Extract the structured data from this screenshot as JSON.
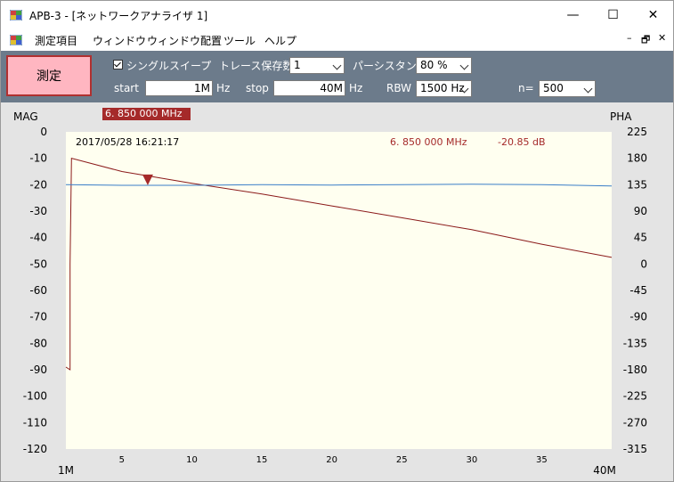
{
  "window": {
    "title": "APB-3 - [ネットワークアナライザ 1]",
    "minimize": "—",
    "maximize": "☐",
    "close": "✕"
  },
  "menu": {
    "items": [
      "測定項目",
      "ウィンドウ",
      "ウィンドウ配置",
      "ツール",
      "ヘルプ"
    ],
    "mdi": [
      "–",
      "🗗",
      "✕"
    ]
  },
  "toolbar": {
    "measure_label": "測定",
    "single_sweep_label": "シングルスイープ",
    "single_sweep_checked": true,
    "trace_save_label": "トレース保存数",
    "trace_save_value": "1",
    "persistence_label": "パーシスタンス",
    "persistence_value": "80 %",
    "start_label": "start",
    "start_value": "1M",
    "start_unit": "Hz",
    "stop_label": "stop",
    "stop_value": "40M",
    "stop_unit": "Hz",
    "rbw_label": "RBW",
    "rbw_value": "1500 Hz",
    "n_label": "n=",
    "n_value": "500"
  },
  "chart": {
    "left_axis_title": "MAG",
    "right_axis_title": "PHA",
    "marker_freq_box": "6. 850 000 MHz",
    "timestamp": "2017/05/28 16:21:17",
    "marker_freq_readout": "6. 850 000 MHz",
    "marker_value_readout": "-20.85 dB",
    "colors": {
      "magnitude": "#8b1a1a",
      "phase": "#3a7ec8",
      "plot_bg": "#fffff0"
    }
  },
  "chart_data": {
    "type": "line",
    "x_range": [
      1,
      40
    ],
    "x_unit": "MHz",
    "x_ticks": [
      5,
      10,
      15,
      20,
      25,
      30,
      35
    ],
    "x_end_labels": [
      "1M",
      "40M"
    ],
    "left_axis": {
      "title": "MAG",
      "range": [
        -120,
        0
      ],
      "ticks": [
        0,
        -10,
        -20,
        -30,
        -40,
        -50,
        -60,
        -70,
        -80,
        -90,
        -100,
        -110,
        -120
      ]
    },
    "right_axis": {
      "title": "PHA",
      "range": [
        -315,
        225
      ],
      "ticks": [
        225,
        180,
        135,
        90,
        45,
        0,
        -45,
        -90,
        -135,
        -180,
        -225,
        -270,
        -315
      ]
    },
    "marker": {
      "x": 6.85,
      "y": -20.85
    },
    "series": [
      {
        "axis": "left",
        "points": [
          [
            1,
            -89
          ],
          [
            1.3,
            -90
          ],
          [
            1.3,
            -50
          ],
          [
            1.4,
            -10
          ],
          [
            5,
            -15
          ],
          [
            10,
            -19.5
          ],
          [
            15,
            -23.5
          ],
          [
            20,
            -28
          ],
          [
            25,
            -32.5
          ],
          [
            30,
            -37
          ],
          [
            35,
            -42.5
          ],
          [
            40,
            -47.5
          ]
        ]
      },
      {
        "axis": "right",
        "points": [
          [
            1,
            135
          ],
          [
            5,
            134
          ],
          [
            10,
            134
          ],
          [
            15,
            135
          ],
          [
            20,
            134.5
          ],
          [
            25,
            135
          ],
          [
            30,
            136
          ],
          [
            35,
            135
          ],
          [
            40,
            133
          ]
        ]
      }
    ]
  }
}
